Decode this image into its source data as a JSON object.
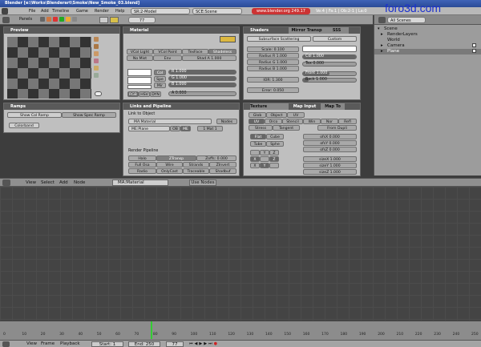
{
  "window": {
    "title": "Blender [e:\\Works\\Blenderart\\Smoke\\New_Smoke_03.blend]"
  },
  "menubar": {
    "items": [
      "File",
      "Add",
      "Timeline",
      "Game",
      "Render",
      "Help"
    ],
    "screen": "SR:2-Model",
    "screen2": "SCE:Scene",
    "url": "www.blender.org 249.17",
    "stats": "Ve:4 | Fa:1 | Ob:2-1 | La:0"
  },
  "watermark": "foro3d.com",
  "buttons_toolbar": {
    "panels": "Panels",
    "frame": "77"
  },
  "preview": {
    "title": "Preview"
  },
  "material": {
    "title": "Material",
    "vcol_light": "VCol Light",
    "vcol_paint": "VCol Paint",
    "texface": "TexFace",
    "shadeless": "Shadeless",
    "no_mist": "No Mist",
    "env": "Env",
    "shad_a": "Shad A 1.000",
    "col": "Col",
    "spe": "Spe",
    "mir": "Mir",
    "r": "R 1.000",
    "g": "G 1.000",
    "b": "B 1.000",
    "rgb": "RGB",
    "hsv": "HSV",
    "dyn": "DYN",
    "alpha": "A 0.000"
  },
  "shaders": {
    "title": "Shaders",
    "tab2": "Mirror Transp",
    "tab3": "SSS",
    "subsurface": "Subsurface Scattering",
    "custom": "Custom",
    "scale": "Scale: 0.100",
    "radius_r": "Radius R 1.000",
    "radius_g": "Radius G 1.000",
    "radius_b": "Radius B 1.000",
    "ior": "IOR: 1.300",
    "error": "Error: 0.050",
    "col": "Col 1.000",
    "tex": "Tex 0.000",
    "front": "Front 1.000",
    "back": "Back 1.000"
  },
  "ramps": {
    "title": "Ramps",
    "show_col": "Show Col Ramp",
    "show_spec": "Show Spec Ramp",
    "colorband": "Colorband"
  },
  "links": {
    "title": "Links and Pipeline",
    "link_to_object": "Link to Object",
    "ma": "MA:Material",
    "nodes": "Nodes",
    "me": "ME:Plane",
    "ob": "OB",
    "me_btn": "ME",
    "mat_count": "1 Mat 1",
    "render_pipeline": "Render Pipeline",
    "halo": "Halo",
    "ztransp": "ZTransp",
    "zoffs": "Zoffs: 0.000",
    "full_osa": "Full Osa",
    "wire": "Wire",
    "strands": "Strands",
    "zinvert": "ZInvert",
    "radio": "Radio",
    "onlycast": "OnlyCast",
    "traceable": "Traceable",
    "shadbuf": "Shadbuf"
  },
  "texture": {
    "title": "Texture",
    "tab2": "Map Input",
    "tab3": "Map To",
    "row1": [
      "Glob",
      "Object",
      "UV"
    ],
    "row2": [
      "UV",
      "Orco",
      "Stencil",
      "Win",
      "Nor",
      "Refl"
    ],
    "row3": [
      "Stress",
      "Tangent",
      "From Dupli"
    ],
    "flat": "Flat",
    "cube": "Cube",
    "tube": "Tube",
    "sphe": "Sphe",
    "ofsx": "ofsX 0.000",
    "ofsy": "ofsY 0.000",
    "ofsz": "ofsZ 0.000",
    "sizex": "sizeX 1.000",
    "sizey": "sizeY 1.000",
    "sizez": "sizeZ 1.000",
    "xyz": [
      "X",
      "Y",
      "Z"
    ]
  },
  "node_header": {
    "view": "View",
    "select": "Select",
    "add": "Add",
    "node": "Node",
    "material": "MA:Material",
    "use_nodes": "Use Nodes"
  },
  "outliner": {
    "search": "All Scenes",
    "items": [
      "Scene",
      "RenderLayers",
      "World",
      "Camera",
      "Plane"
    ]
  },
  "timeline": {
    "ticks": [
      "0",
      "10",
      "20",
      "30",
      "40",
      "50",
      "60",
      "70",
      "80",
      "90",
      "100",
      "110",
      "120",
      "130",
      "140",
      "150",
      "160",
      "170",
      "180",
      "190",
      "200",
      "210",
      "220",
      "230",
      "240",
      "250"
    ],
    "current_frame": 77
  },
  "status": {
    "view": "View",
    "frame": "Frame",
    "playback": "Playback",
    "start": "Start: 1",
    "end": "End: 250",
    "cur": "77"
  },
  "colors": {
    "accent": "#3f63b8",
    "panel": "#bfbfbf",
    "grid": "#444444"
  }
}
